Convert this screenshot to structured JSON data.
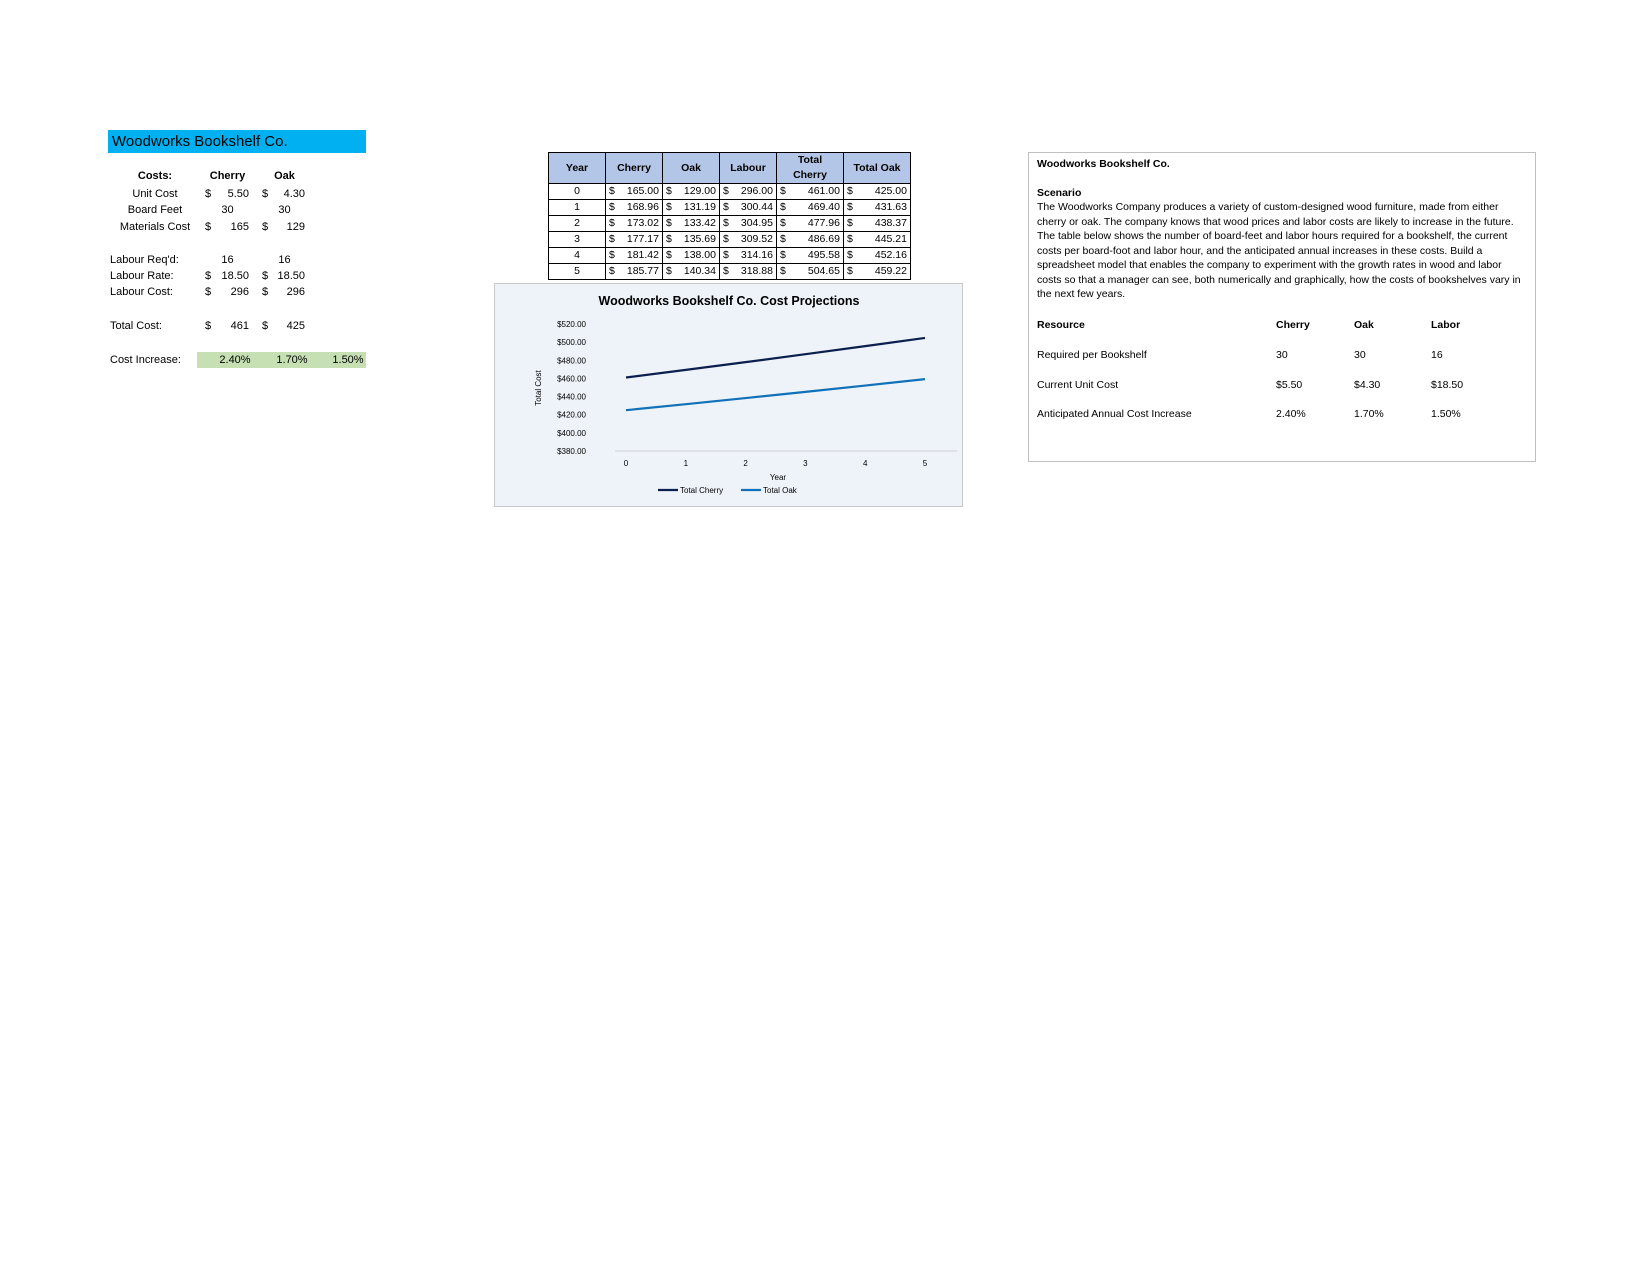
{
  "model": {
    "title": "Woodworks Bookshelf Co.",
    "costs_label": "Costs:",
    "col_cherry": "Cherry",
    "col_oak": "Oak",
    "rows": [
      {
        "label": "Unit Cost",
        "cherry_sym": "$",
        "cherry": "5.50",
        "oak_sym": "$",
        "oak": "4.30"
      },
      {
        "label": "Board Feet",
        "cherry_sym": "",
        "cherry": "30",
        "oak_sym": "",
        "oak": "30"
      },
      {
        "label": "Materials Cost",
        "cherry_sym": "$",
        "cherry": "165",
        "oak_sym": "$",
        "oak": "129"
      },
      {
        "label": "Labour Req'd:",
        "cherry_sym": "",
        "cherry": "16",
        "oak_sym": "",
        "oak": "16"
      },
      {
        "label": "Labour Rate:",
        "cherry_sym": "$",
        "cherry": "18.50",
        "oak_sym": "$",
        "oak": "18.50"
      },
      {
        "label": "Labour Cost:",
        "cherry_sym": "$",
        "cherry": "296",
        "oak_sym": "$",
        "oak": "296"
      },
      {
        "label": "Total Cost:",
        "cherry_sym": "$",
        "cherry": "461",
        "oak_sym": "$",
        "oak": "425"
      }
    ],
    "increase_label": "Cost Increase:",
    "increase_values": [
      "2.40%",
      "1.70%",
      "1.50%"
    ]
  },
  "projection": {
    "headers": [
      "Year",
      "Cherry",
      "Oak",
      "Labour",
      "Total Cherry",
      "Total Oak"
    ],
    "rows": [
      [
        "0",
        "165.00",
        "129.00",
        "296.00",
        "461.00",
        "425.00"
      ],
      [
        "1",
        "168.96",
        "131.19",
        "300.44",
        "469.40",
        "431.63"
      ],
      [
        "2",
        "173.02",
        "133.42",
        "304.95",
        "477.96",
        "438.37"
      ],
      [
        "3",
        "177.17",
        "135.69",
        "309.52",
        "486.69",
        "445.21"
      ],
      [
        "4",
        "181.42",
        "138.00",
        "314.16",
        "495.58",
        "452.16"
      ],
      [
        "5",
        "185.77",
        "140.34",
        "318.88",
        "504.65",
        "459.22"
      ]
    ],
    "currency": "$"
  },
  "chart_data": {
    "type": "line",
    "title": "Woodworks Bookshelf Co. Cost Projections",
    "xlabel": "Year",
    "ylabel": "Total Cost",
    "x": [
      0,
      1,
      2,
      3,
      4,
      5
    ],
    "y_ticks": [
      "$380.00",
      "$400.00",
      "$420.00",
      "$440.00",
      "$460.00",
      "$480.00",
      "$500.00",
      "$520.00"
    ],
    "ylim": [
      380,
      520
    ],
    "series": [
      {
        "name": "Total Cherry",
        "color": "#0b1f4f",
        "values": [
          461.0,
          469.4,
          477.96,
          486.69,
          495.58,
          504.65
        ]
      },
      {
        "name": "Total Oak",
        "color": "#1070b8",
        "values": [
          425.0,
          431.63,
          438.37,
          445.21,
          452.16,
          459.22
        ]
      }
    ],
    "legend": "bottom",
    "grid": false
  },
  "scenario": {
    "company": "Woodworks Bookshelf Co.",
    "heading": "Scenario",
    "text": "The Woodworks Company produces a variety of custom-designed wood furniture, made from either cherry or oak. The company knows that wood prices and labor costs are likely to increase in the future. The table below shows the number of board-feet and labor hours required for a bookshelf, the current costs per board-foot and labor hour, and the anticipated annual increases in these costs. Build a spreadsheet model that enables the company to experiment with the growth rates in wood and labor costs so that a manager can see, both numerically and graphically, how the costs of bookshelves vary in the next few years.",
    "table_headers": [
      "Resource",
      "Cherry",
      "Oak",
      "Labor"
    ],
    "table_rows": [
      [
        "Required per Bookshelf",
        "30",
        "30",
        "16"
      ],
      [
        "Current Unit Cost",
        "$5.50",
        "$4.30",
        "$18.50"
      ],
      [
        "Anticipated Annual Cost Increase",
        "2.40%",
        "1.70%",
        "1.50%"
      ]
    ]
  }
}
